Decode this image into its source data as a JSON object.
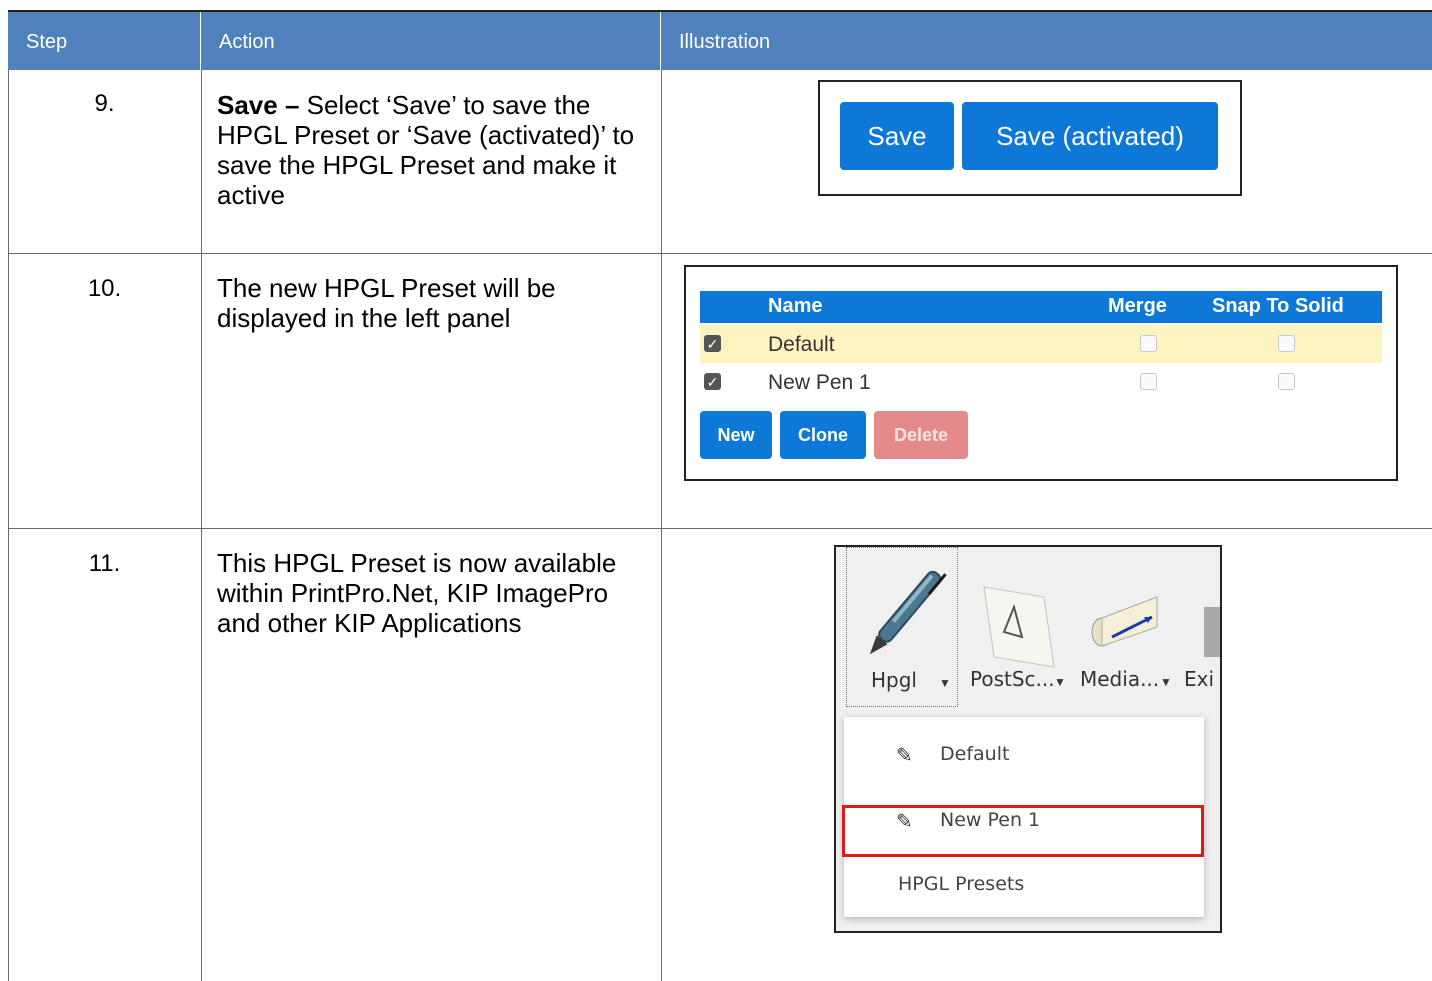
{
  "header": {
    "step": "Step",
    "action": "Action",
    "illustration": "Illustration"
  },
  "rows": [
    {
      "step": "9.",
      "action_bold": "Save –",
      "action_text": " Select ‘Save’ to save the HPGL Preset or ‘Save (activated)’ to save the HPGL Preset and make it active"
    },
    {
      "step": "10.",
      "action_text": "The new HPGL Preset will be displayed in the left panel"
    },
    {
      "step": "11.",
      "action_text": "This HPGL Preset is now available within PrintPro.Net, KIP ImagePro and other KIP Applications"
    }
  ],
  "illus_save": {
    "save_label": "Save",
    "save_activated_label": "Save (activated)"
  },
  "illus_panel": {
    "col_name": "Name",
    "col_merge": "Merge",
    "col_snap": "Snap To Solid",
    "items": [
      {
        "name": "Default",
        "checked": true,
        "merge": false,
        "snap": false
      },
      {
        "name": "New Pen 1",
        "checked": true,
        "merge": false,
        "snap": false
      }
    ],
    "new_label": "New",
    "clone_label": "Clone",
    "delete_label": "Delete"
  },
  "illus_menu": {
    "toolbar": [
      "Hpgl",
      "PostSc...",
      "Media...",
      "Exi"
    ],
    "items": [
      "Default",
      "New Pen 1"
    ],
    "footer": "HPGL Presets"
  },
  "colors": {
    "header_bg": "#4f81bd",
    "button_blue": "#0d78d8",
    "delete_disabled": "#e58a8a",
    "highlight_row": "#fdf3c0",
    "selection_border": "#e01818"
  }
}
